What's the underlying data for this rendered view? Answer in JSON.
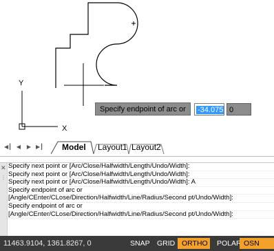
{
  "drawing": {
    "ucs_icon": {
      "x_label": "X",
      "y_label": "Y"
    },
    "dynamic_input": {
      "prompt": "Specify endpoint of arc or",
      "value": "-34.0757",
      "second_value": "0"
    }
  },
  "tabs": {
    "nav": [
      "first-tab",
      "previous-tab",
      "next-tab",
      "last-tab"
    ],
    "items": [
      {
        "label": "Model",
        "active": true
      },
      {
        "label": "Layout1",
        "active": false
      },
      {
        "label": "Layout2",
        "active": false
      }
    ]
  },
  "command_line": {
    "lines": [
      "Specify next point or [Arc/Close/Halfwidth/Length/Undo/Width]:",
      "Specify next point or [Arc/Close/Halfwidth/Length/Undo/Width]:",
      "Specify next point or [Arc/Close/Halfwidth/Length/Undo/Width]: A",
      "Specify endpoint of arc or",
      "[Angle/CEnter/CLose/Direction/Halfwidth/Line/Radius/Second pt/Undo/Width]:",
      "Specify endpoint of arc or",
      "[Angle/CEnter/CLose/Direction/Halfwidth/Line/Radius/Second pt/Undo/Width]:"
    ]
  },
  "status_bar": {
    "coordinates": "11463.9104, 1361.8267, 0",
    "buttons": [
      {
        "label": "SNAP",
        "on": false
      },
      {
        "label": "GRID",
        "on": false
      },
      {
        "label": "ORTHO",
        "on": true
      },
      {
        "label": "POLAR",
        "on": false
      },
      {
        "label": "OSN",
        "on": true
      }
    ]
  },
  "colors": {
    "status_bg": "#3a3a3a",
    "toggle_on": "#f3a12a",
    "tooltip_bg": "#8c8c8c",
    "selection": "#3399ff"
  }
}
